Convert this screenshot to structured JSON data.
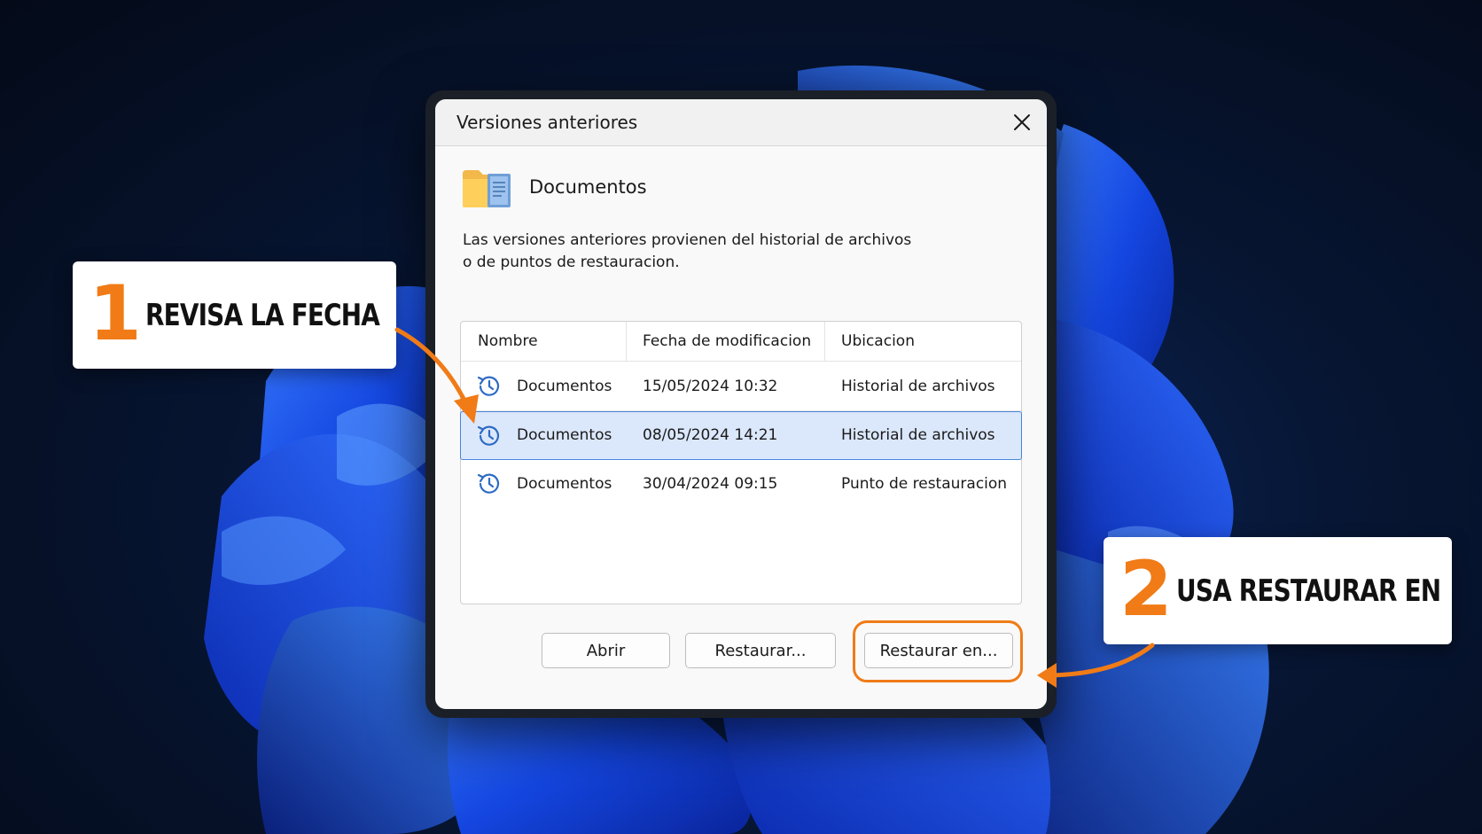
{
  "dialog": {
    "title": "Versiones anteriores",
    "folder_name": "Documentos",
    "description_line1": "Las versiones anteriores provienen del historial de archivos",
    "description_line2": "o de puntos de restauracion."
  },
  "list": {
    "columns": [
      "Nombre",
      "Fecha de modificacion",
      "Ubicacion"
    ],
    "rows": [
      {
        "name": "Documentos",
        "date": "15/05/2024 10:32",
        "location": "Historial de archivos",
        "selected": false
      },
      {
        "name": "Documentos",
        "date": "08/05/2024 14:21",
        "location": "Historial de archivos",
        "selected": true
      },
      {
        "name": "Documentos",
        "date": "30/04/2024 09:15",
        "location": "Punto de restauracion",
        "selected": false
      }
    ]
  },
  "buttons": {
    "open": "Abrir",
    "restore": "Restaurar...",
    "restore_to": "Restaurar en..."
  },
  "callouts": {
    "one": {
      "number": "1",
      "text": "REVISA LA FECHA"
    },
    "two": {
      "number": "2",
      "text": "USA RESTAURAR EN"
    }
  },
  "colors": {
    "accent": "#f07b17",
    "selection": "#dbe7fb",
    "selection_border": "#4a86d8",
    "wallpaper_blue": "#1e5bff"
  },
  "icons": {
    "close": "close-icon",
    "folder": "folder-document-icon",
    "history": "history-clock-icon"
  }
}
